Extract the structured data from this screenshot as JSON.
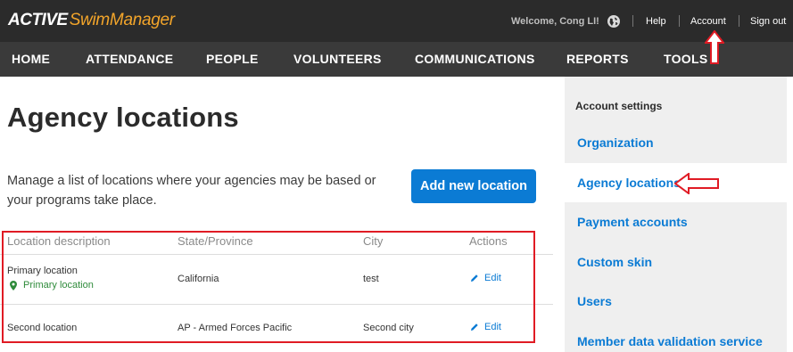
{
  "app": {
    "logo_part1": "ACTIVE",
    "logo_part2": "SwimManager"
  },
  "topbar": {
    "welcome": "Welcome, Cong LI!",
    "help": "Help",
    "account": "Account",
    "signout": "Sign out",
    "globe_icon": "globe-icon"
  },
  "nav": {
    "items": [
      "HOME",
      "ATTENDANCE",
      "PEOPLE",
      "VOLUNTEERS",
      "COMMUNICATIONS",
      "REPORTS",
      "TOOLS"
    ]
  },
  "main": {
    "title": "Agency locations",
    "description": "Manage a list of locations where your agencies may be based or your programs take place.",
    "add_button": "Add new location",
    "table": {
      "headers": [
        "Location description",
        "State/Province",
        "City",
        "Actions"
      ],
      "rows": [
        {
          "description": "Primary location",
          "primary_tag": "Primary location",
          "state": "California",
          "city": "test",
          "action": "Edit"
        },
        {
          "description": "Second location",
          "primary_tag": "",
          "state": "AP - Armed Forces Pacific",
          "city": "Second city",
          "action": "Edit"
        }
      ]
    }
  },
  "sidebar": {
    "heading": "Account settings",
    "items": [
      {
        "label": "Organization",
        "active": false
      },
      {
        "label": "Agency locations",
        "active": true
      },
      {
        "label": "Payment accounts",
        "active": false
      },
      {
        "label": "Custom skin",
        "active": false
      },
      {
        "label": "Users",
        "active": false
      },
      {
        "label": "Member data validation service",
        "active": false
      }
    ]
  },
  "colors": {
    "topbar": "#2b2b2b",
    "navbar": "#3a3a3a",
    "accent": "#0b7bd4",
    "logo_orange": "#f3a52a",
    "primary_green": "#2e8b3a",
    "annotation_red": "#e01b24"
  }
}
